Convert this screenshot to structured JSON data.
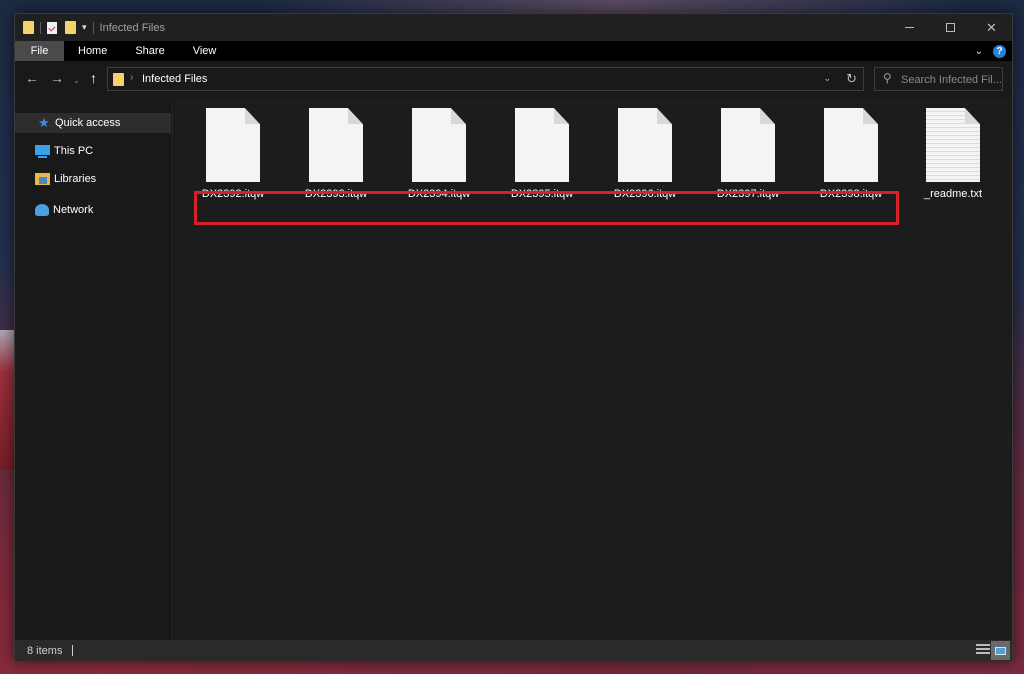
{
  "window": {
    "title": "Infected Files",
    "controls": {
      "minimize": "minimize",
      "maximize": "maximize",
      "close": "✕"
    }
  },
  "quick_access_toolbar": {
    "icons": [
      "folder-icon",
      "properties-icon",
      "new-folder-icon",
      "customize-dropdown-icon"
    ],
    "dropdown_glyph": "▾"
  },
  "ribbon": {
    "tabs": [
      {
        "label": "File",
        "active": true
      },
      {
        "label": "Home"
      },
      {
        "label": "Share"
      },
      {
        "label": "View"
      }
    ],
    "expand_glyph": "⌄",
    "help_glyph": "?"
  },
  "navigation": {
    "back_glyph": "←",
    "forward_glyph": "→",
    "recent_glyph": "⌄",
    "up_glyph": "↑",
    "address": {
      "separator": "›",
      "path": "Infected Files",
      "dropdown_glyph": "⌄",
      "refresh_glyph": "↻"
    },
    "search": {
      "placeholder": "Search Infected Fil...",
      "icon_glyph": "⚲"
    }
  },
  "sidebar": {
    "items": [
      {
        "label": "Quick access",
        "icon": "star-icon",
        "active": true
      },
      {
        "label": "This PC",
        "icon": "computer-icon"
      },
      {
        "label": "Libraries",
        "icon": "libraries-icon"
      },
      {
        "label": "Network",
        "icon": "network-icon"
      }
    ]
  },
  "files": [
    {
      "name": "DX2392.itqw",
      "type": "generic"
    },
    {
      "name": "DX2393.itqw",
      "type": "generic"
    },
    {
      "name": "DX2394.itqw",
      "type": "generic"
    },
    {
      "name": "DX2395.itqw",
      "type": "generic"
    },
    {
      "name": "DX2396.itqw",
      "type": "generic"
    },
    {
      "name": "DX2397.itqw",
      "type": "generic"
    },
    {
      "name": "DX2398.itqw",
      "type": "generic"
    },
    {
      "name": "_readme.txt",
      "type": "text"
    }
  ],
  "annotation": {
    "highlight_color": "#d8202a",
    "highlighted_files": [
      "DX2392.itqw",
      "DX2393.itqw",
      "DX2394.itqw",
      "DX2395.itqw",
      "DX2396.itqw",
      "DX2397.itqw",
      "DX2398.itqw"
    ]
  },
  "status_bar": {
    "item_count": "8 items",
    "views": [
      "details-view",
      "large-icons-view"
    ],
    "active_view": "large-icons-view"
  },
  "colors": {
    "accent": "#2b7fd4",
    "folder": "#f3d46a",
    "window_bg": "#191919"
  }
}
